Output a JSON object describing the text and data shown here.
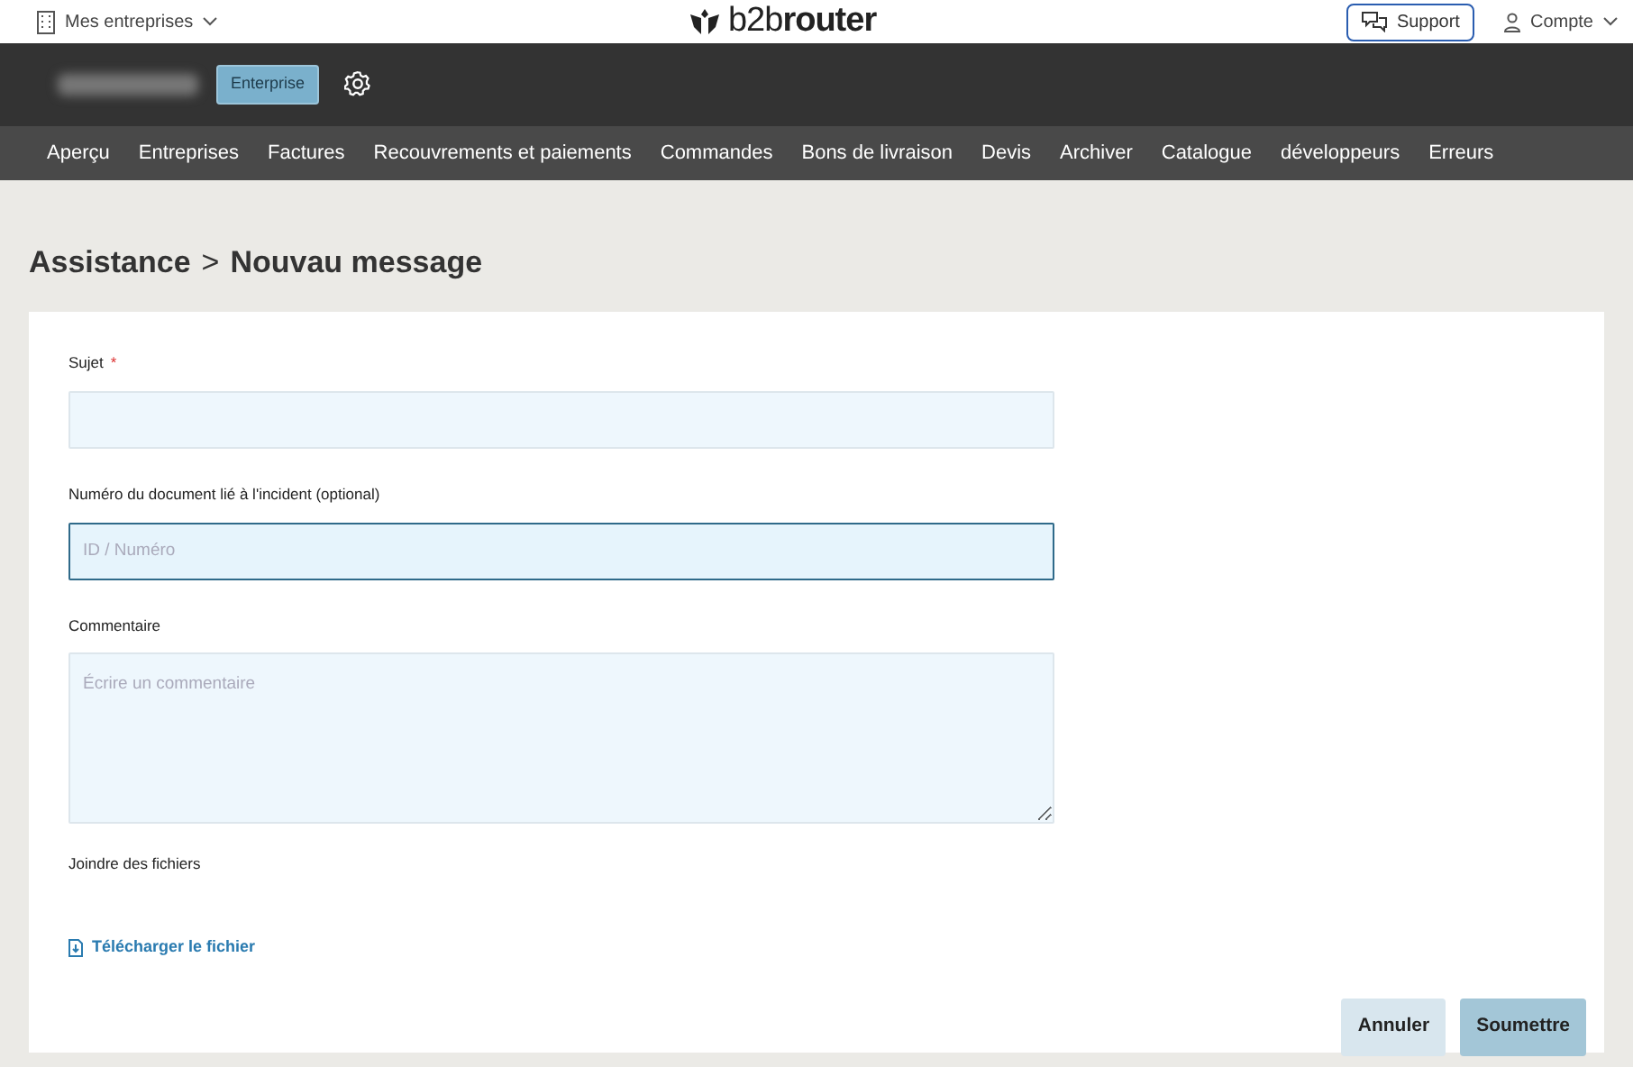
{
  "topbar": {
    "companies_menu": "Mes entreprises",
    "logo": {
      "prefix": "b2b",
      "suffix": "router"
    },
    "support_button": "Support",
    "account_menu": "Compte"
  },
  "company_bar": {
    "plan_badge": "Enterprise"
  },
  "nav": [
    "Aperçu",
    "Entreprises",
    "Factures",
    "Recouvrements et paiements",
    "Commandes",
    "Bons de livraison",
    "Devis",
    "Archiver",
    "Catalogue",
    "développeurs",
    "Erreurs"
  ],
  "breadcrumb": {
    "parent": "Assistance",
    "separator": ">",
    "current": "Nouvau message"
  },
  "form": {
    "fields": [
      {
        "kind": "input",
        "label": "Sujet",
        "required_mark": "*",
        "focused": false
      },
      {
        "kind": "input",
        "label": "Numéro du document lié à l'incident (optional)",
        "placeholder": "ID / Numéro",
        "focused": true
      },
      {
        "kind": "textarea",
        "label": "Commentaire",
        "placeholder": "Écrire un commentaire",
        "focused": false
      }
    ],
    "attach_label": "Joindre des fichiers",
    "upload_link": "Télécharger le fichier",
    "buttons": [
      {
        "label": "Annuler",
        "kind": "secondary"
      },
      {
        "label": "Soumettre",
        "kind": "primary"
      }
    ]
  }
}
